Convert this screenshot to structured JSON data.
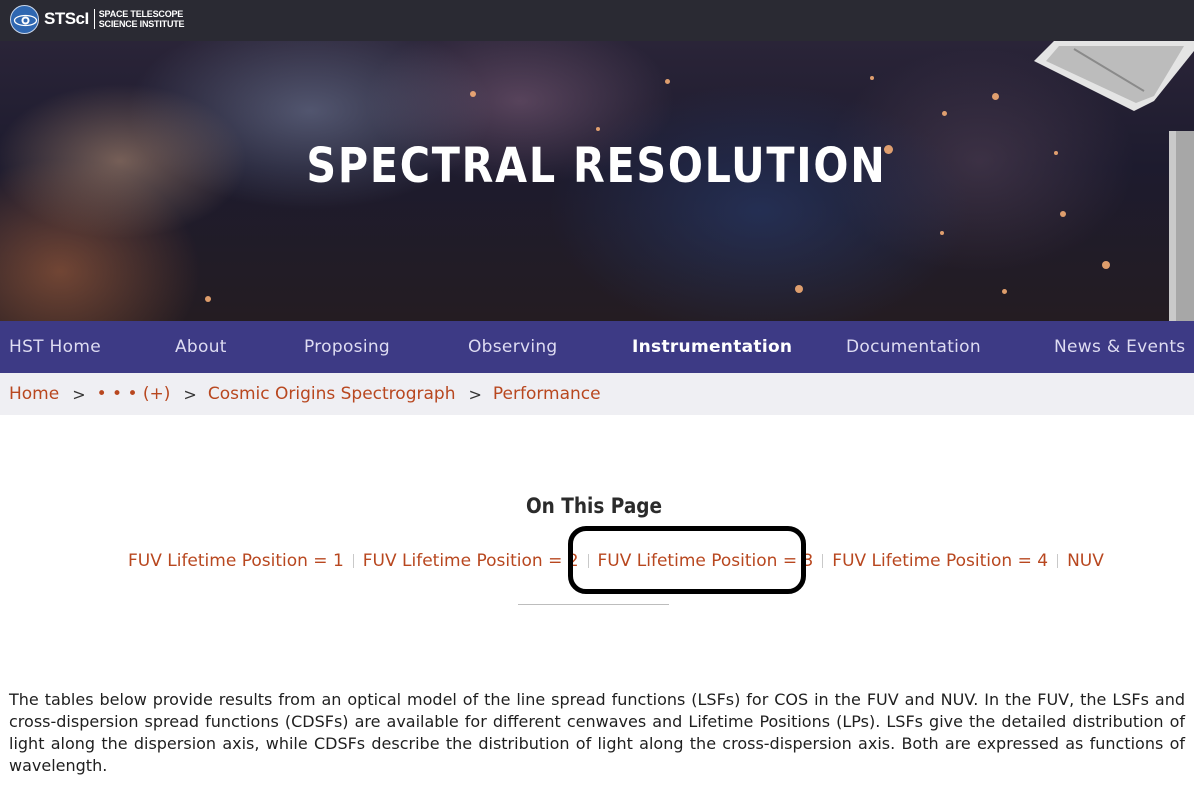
{
  "brand": {
    "abbr": "STScI",
    "name_line1": "SPACE TELESCOPE",
    "name_line2": "SCIENCE INSTITUTE",
    "logo_icon": "stsci-logo-icon"
  },
  "hero": {
    "title": "SPECTRAL RESOLUTION"
  },
  "nav": {
    "items": [
      {
        "label": "HST Home"
      },
      {
        "label": "About"
      },
      {
        "label": "Proposing"
      },
      {
        "label": "Observing"
      },
      {
        "label": "Instrumentation"
      },
      {
        "label": "Documentation"
      },
      {
        "label": "News & Events"
      }
    ],
    "active": "Instrumentation"
  },
  "breadcrumb": {
    "items": [
      "Home",
      "• • • (+)",
      "Cosmic Origins Spectrograph",
      "Performance"
    ],
    "separator": ">"
  },
  "on_this_page": {
    "title": "On This Page",
    "links": [
      "FUV Lifetime Position = 1",
      "FUV Lifetime Position = 2",
      "FUV Lifetime Position = 3",
      "FUV Lifetime Position = 4",
      "NUV"
    ]
  },
  "intro": {
    "text": "The tables below provide results from an optical model of the line spread functions (LSFs) for COS in the FUV and NUV. In the FUV, the LSFs and cross-dispersion spread functions (CDSFs) are available for different cenwaves and Lifetime Positions (LPs). LSFs give the detailed distribution of light along the dispersion axis, while CDSFs describe the distribution of light along the cross-dispersion axis. Both are expressed as functions of wavelength."
  },
  "colors": {
    "topbar": "#2a2a33",
    "nav": "#3d3a85",
    "link": "#b8471f",
    "crumb_bg": "#efeff3"
  }
}
